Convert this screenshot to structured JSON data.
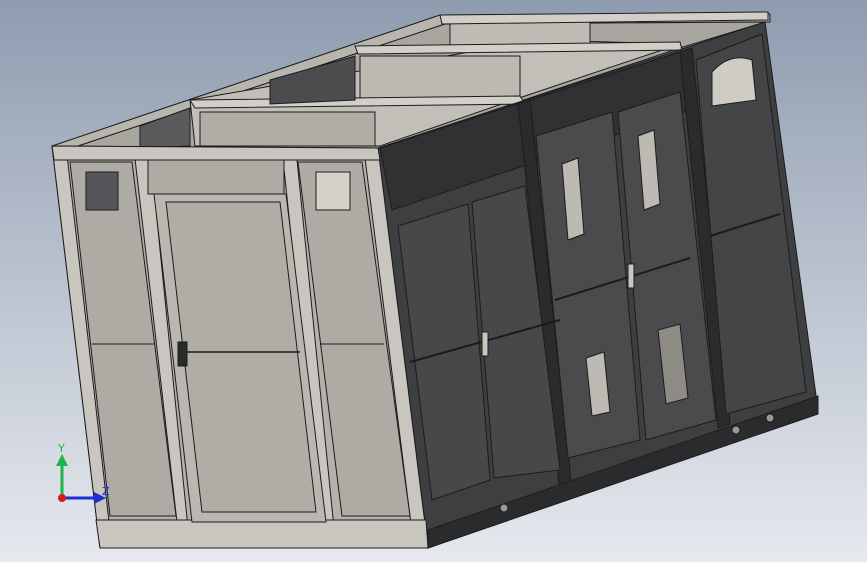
{
  "viewport": {
    "background_top": "#8f9cb0",
    "background_bottom": "#e6e9ee"
  },
  "triad": {
    "y_label": "Y",
    "z_label": "Z",
    "y_color": "#1fb34a",
    "z_color": "#1d2fd6",
    "x_color": "#d01d1d"
  },
  "model": {
    "front_panel_color": "#b4b1aa",
    "side_panel_color": "#3e3f41",
    "roof_frame_color": "#c9c6bf",
    "edge_color": "#1c1c1c"
  }
}
